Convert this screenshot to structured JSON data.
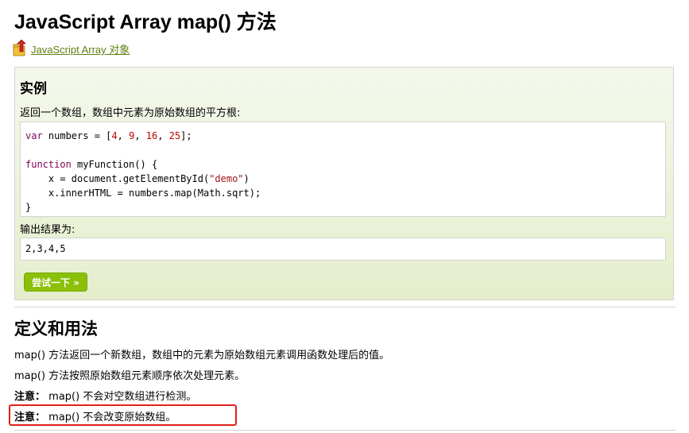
{
  "page": {
    "title": "JavaScript Array map() 方法"
  },
  "back_link": {
    "icon": "back-arrow-folder-icon",
    "label": "JavaScript Array 对象"
  },
  "example": {
    "heading": "实例",
    "description": "返回一个数组，数组中元素为原始数组的平方根:",
    "code_lines": [
      "var numbers = [4, 9, 16, 25];",
      "",
      "function myFunction() {",
      "    x = document.getElementById(\"demo\")",
      "    x.innerHTML = numbers.map(Math.sqrt);",
      "}"
    ],
    "output_label": "输出结果为:",
    "output_value": "2,3,4,5",
    "try_button_label": "尝试一下 »"
  },
  "definition": {
    "heading": "定义和用法",
    "para1": "map() 方法返回一个新数组，数组中的元素为原始数组元素调用函数处理后的值。",
    "para2": "map() 方法按照原始数组元素顺序依次处理元素。",
    "note1_label": "注意：",
    "note1_text": "map() 不会对空数组进行检测。",
    "note2_label": "注意：",
    "note2_text": "map() 不会改变原始数组。"
  },
  "colors": {
    "accent_green": "#8ac007",
    "highlight_red": "#e0201b",
    "link_green": "#617f10"
  }
}
